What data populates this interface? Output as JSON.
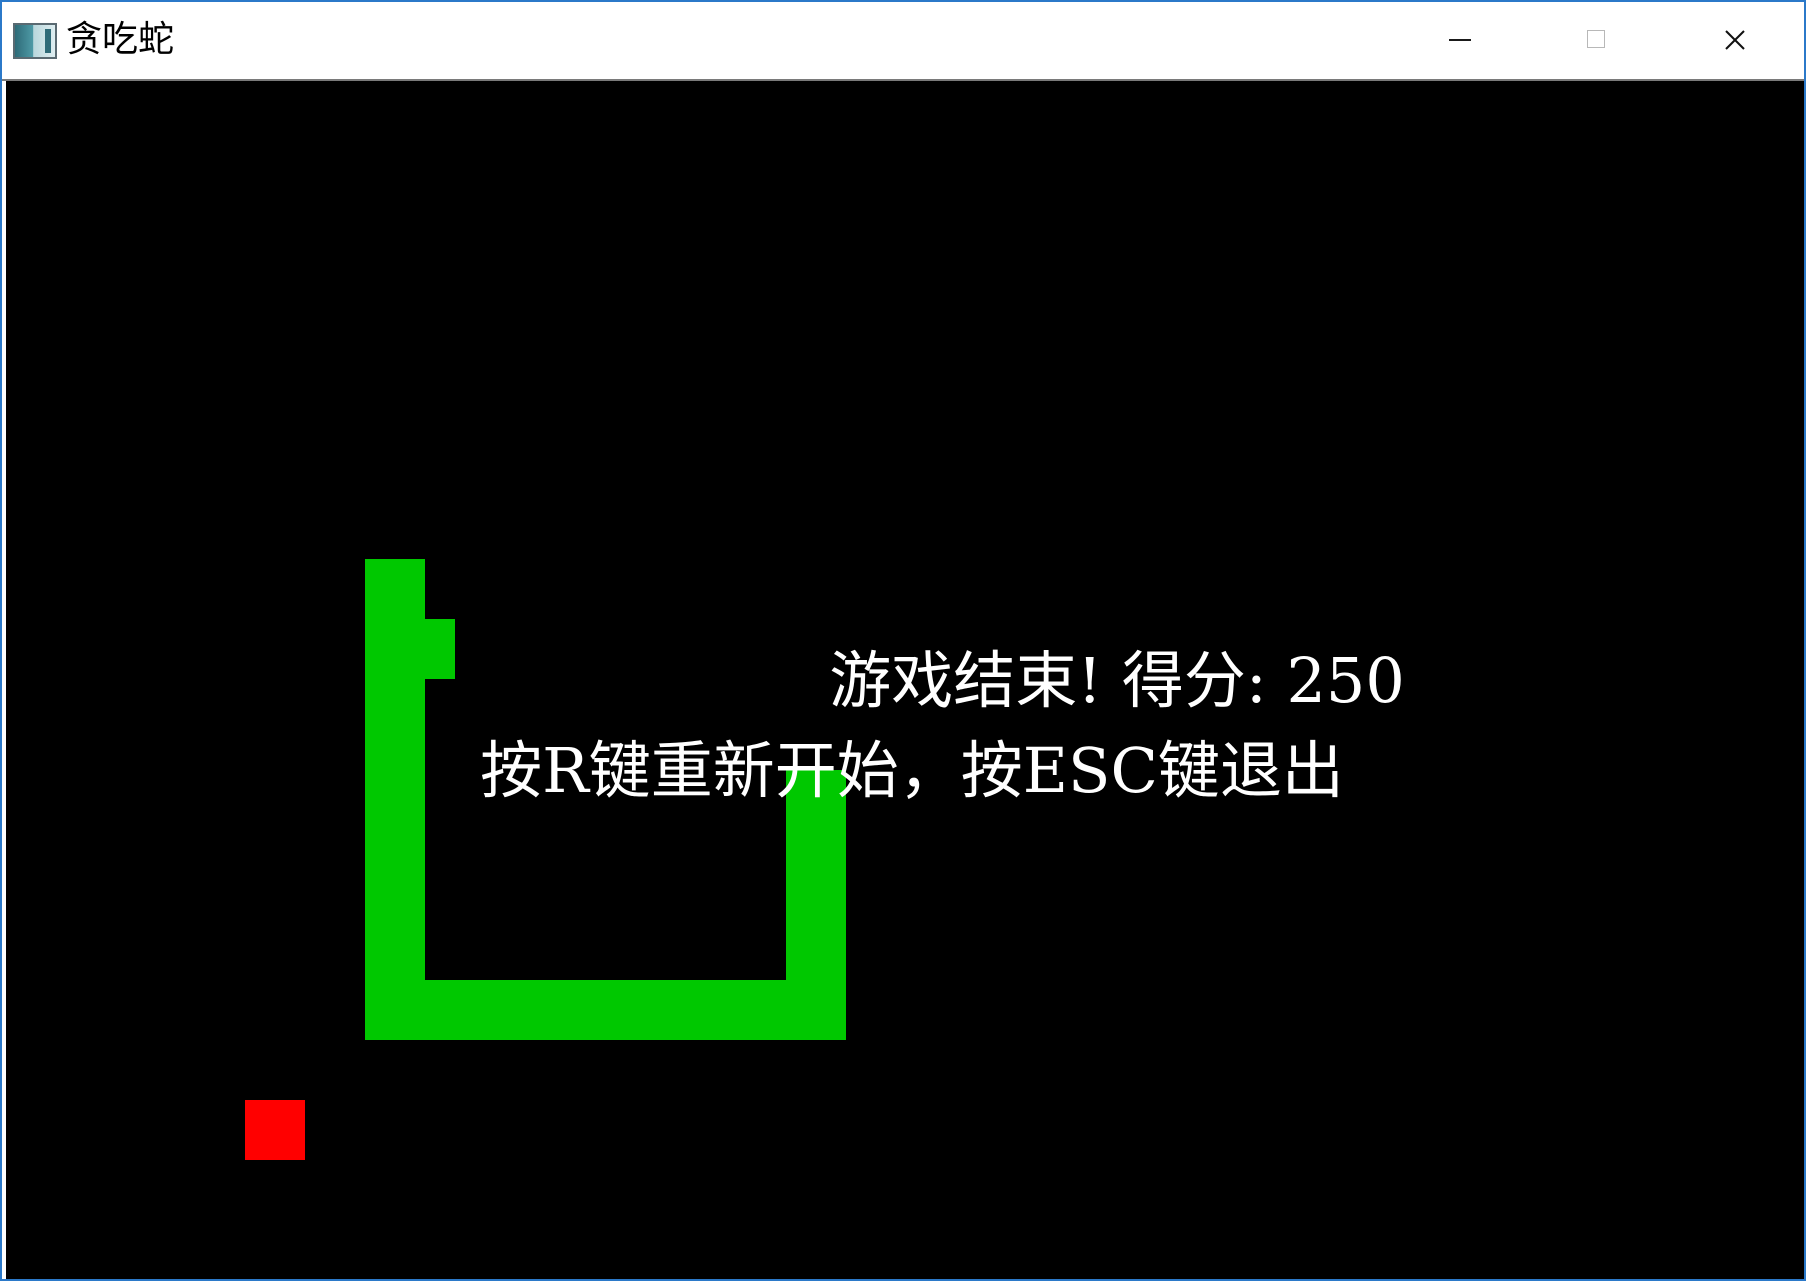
{
  "window": {
    "title": "贪吃蛇"
  },
  "game": {
    "colors": {
      "background": "#000000",
      "snake": "#00c800",
      "food": "#ff0000",
      "text": "#ffffff"
    },
    "game_over_text": "游戏结束! 得分: 250",
    "instructions_text": "按R键重新开始，按ESC键退出"
  },
  "icons": {
    "app": "app-window-icon",
    "minimize": "minimize-icon",
    "maximize": "maximize-icon",
    "close": "close-icon"
  }
}
